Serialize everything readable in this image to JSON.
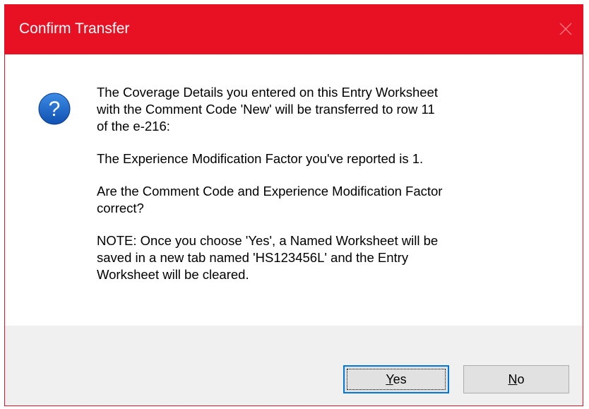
{
  "window": {
    "title": "Confirm Transfer",
    "close_icon": "close-icon",
    "accent_color": "#e81123"
  },
  "message": {
    "icon": "question-icon",
    "icon_color": "#1e64c8",
    "line1": "The Coverage Details you entered on this Entry Worksheet",
    "line2": "with the Comment Code 'New' will be transferred to row 11",
    "line3": "of the e-216:",
    "paragraph2": "The Experience Modification Factor you've reported is 1.",
    "paragraph3_line1": "Are the Comment Code and Experience Modification Factor",
    "paragraph3_line2": "correct?",
    "paragraph4_line1": "NOTE: Once you choose 'Yes', a Named Worksheet will be",
    "paragraph4_line2": "saved in a new tab named 'HS123456L' and the Entry",
    "paragraph4_line3": "Worksheet will be cleared."
  },
  "buttons": {
    "yes": {
      "mnemonic": "Y",
      "rest": "es"
    },
    "no": {
      "mnemonic": "N",
      "rest": "o"
    }
  }
}
